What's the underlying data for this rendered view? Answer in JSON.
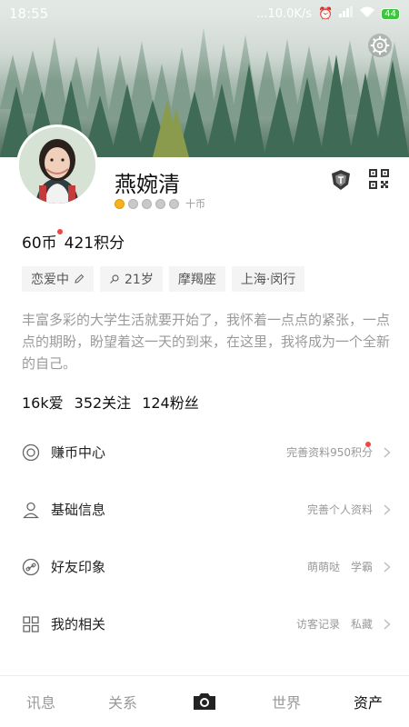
{
  "status_bar": {
    "time": "18:55",
    "network_speed": "...10.0K/s",
    "battery": "44"
  },
  "profile": {
    "name": "燕婉清",
    "level_label": "十币",
    "coins": "60币",
    "points": "421积分",
    "tags": [
      {
        "label": "恋爱中",
        "icon": "pencil-icon"
      },
      {
        "label": "21岁",
        "icon": "gender-icon"
      },
      {
        "label": "摩羯座"
      },
      {
        "label": "上海·闵行"
      }
    ],
    "bio": "丰富多彩的大学生活就要开始了，我怀着一点点的紧张，一点点的期盼，盼望着这一天的到来，在这里，我将成为一个全新的自己。",
    "stats": {
      "likes": "16k爱",
      "following": "352关注",
      "fans": "124粉丝"
    }
  },
  "menu": [
    {
      "title": "赚币中心",
      "icon": "target-icon",
      "right": [
        "完善资料950积分"
      ]
    },
    {
      "title": "基础信息",
      "icon": "person-icon",
      "right": [
        "完善个人资料"
      ]
    },
    {
      "title": "好友印象",
      "icon": "link-icon",
      "right": [
        "萌萌哒",
        "学霸"
      ]
    },
    {
      "title": "我的相关",
      "icon": "grid-icon",
      "right": [
        "访客记录",
        "私藏"
      ]
    }
  ],
  "tabs": [
    {
      "label": "讯息",
      "active": false
    },
    {
      "label": "关系",
      "active": false
    },
    {
      "label": "",
      "icon": "camera-icon"
    },
    {
      "label": "世界",
      "active": false
    },
    {
      "label": "资产",
      "active": true
    }
  ],
  "colors": {
    "accent_gold": "#f3b41e",
    "red_dot": "#f04545",
    "forest_dark": "#2f5a44"
  }
}
